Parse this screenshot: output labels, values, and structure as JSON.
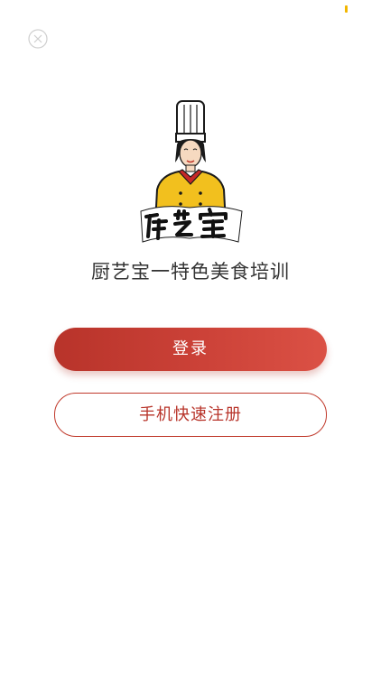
{
  "app": {
    "title": "厨艺宝一特色美食培训",
    "logo_text": "厨艺宝"
  },
  "actions": {
    "login_label": "登录",
    "register_label": "手机快速注册"
  },
  "icons": {
    "close": "close-icon",
    "logo": "chef-logo-icon"
  },
  "colors": {
    "primary": "#c0392b",
    "primary_gradient_end": "#db5145",
    "text": "#333333",
    "status_indicator": "#f2b600"
  }
}
